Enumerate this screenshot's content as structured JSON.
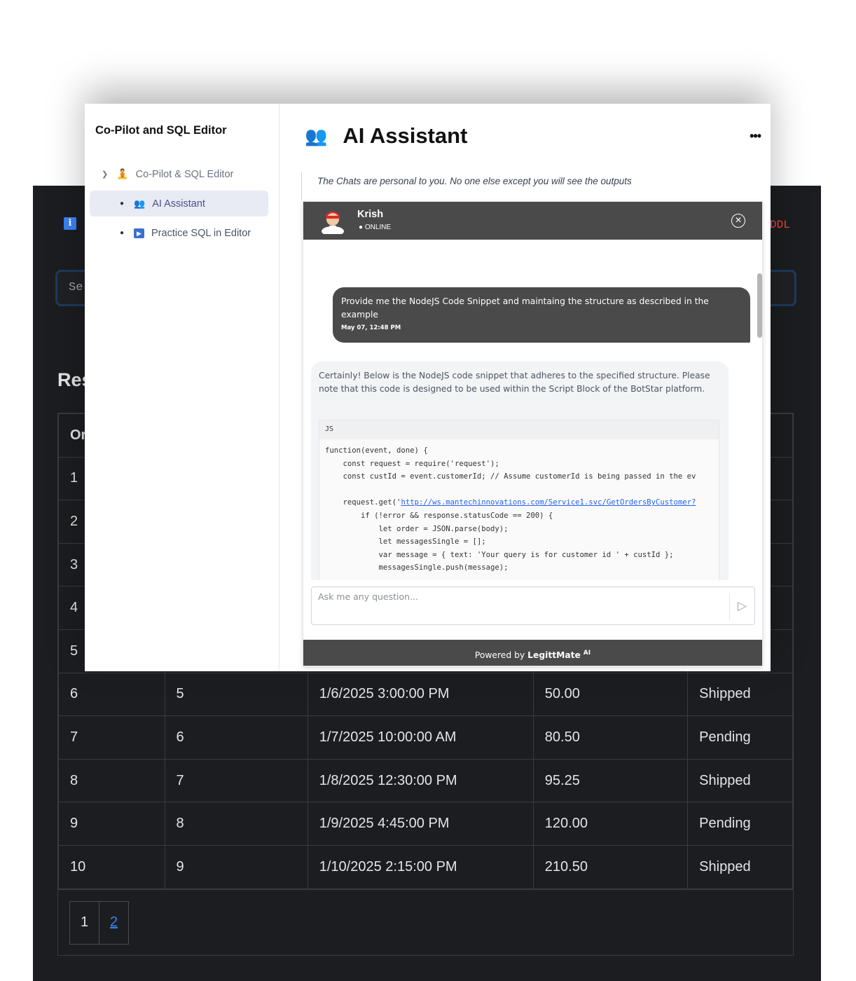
{
  "background": {
    "ddl_link": "DDL",
    "search_placeholder": "Se",
    "results_title": "Res",
    "table": {
      "header_first": "Or",
      "rows": [
        [
          "1",
          "",
          "",
          "",
          ""
        ],
        [
          "2",
          "",
          "",
          "",
          ""
        ],
        [
          "3",
          "",
          "",
          "",
          ""
        ],
        [
          "4",
          "",
          "",
          "",
          ""
        ],
        [
          "5",
          "",
          "",
          "",
          ""
        ],
        [
          "6",
          "5",
          "1/6/2025 3:00:00 PM",
          "50.00",
          "Shipped"
        ],
        [
          "7",
          "6",
          "1/7/2025 10:00:00 AM",
          "80.50",
          "Pending"
        ],
        [
          "8",
          "7",
          "1/8/2025 12:30:00 PM",
          "95.25",
          "Shipped"
        ],
        [
          "9",
          "8",
          "1/9/2025 4:45:00 PM",
          "120.00",
          "Pending"
        ],
        [
          "10",
          "9",
          "1/10/2025 2:15:00 PM",
          "210.50",
          "Shipped"
        ]
      ]
    },
    "pagination": {
      "current": "1",
      "next": "2"
    }
  },
  "sidebar": {
    "title": "Co-Pilot and SQL Editor",
    "group_label": "Co-Pilot & SQL Editor",
    "items": [
      {
        "label": "AI Assistant",
        "icon": "users-icon",
        "active": true
      },
      {
        "label": "Practice SQL in Editor",
        "icon": "play-box-icon",
        "active": false
      }
    ]
  },
  "main": {
    "title": "AI Assistant",
    "notice": "The Chats are personal to you. No one else except you will see the outputs"
  },
  "chat": {
    "agent_name": "Krish",
    "agent_status": "● ONLINE",
    "user_message": "Provide me the NodeJS Code Snippet and maintaing the structure as described in the example",
    "user_timestamp": "May 07, 12:48 PM",
    "bot_text": "Certainly! Below is the NodeJS code snippet that adheres to the specified structure. Please note that this code is designed to be used within the Script Block of the BotStar platform.",
    "code_lang": "JS",
    "code_lines": [
      "function(event, done) {",
      "    const request = require('request');",
      "    const custId = event.customerId; // Assume customerId is being passed in the ev",
      "",
      "    request.get('",
      "        if (!error && response.statusCode == 200) {",
      "            let order = JSON.parse(body);",
      "            let messagesSingle = [];",
      "            var message = { text: 'Your query is for customer id ' + custId };",
      "            messagesSingle.push(message);",
      "            ..."
    ],
    "code_url": "http://ws.mantechinnovations.com/Service1.svc/GetOrdersByCustomer?",
    "input_placeholder": "Ask me any question...",
    "footer_prefix": "Powered by",
    "footer_brand": "LegittMate",
    "footer_sup": "AI"
  },
  "colors": {
    "dark_bg": "#1c1d20",
    "chat_header": "#4a4a4a",
    "active_nav": "#e8ebf4",
    "link_blue": "#3b82f6",
    "ddl_red": "#ef4444"
  }
}
